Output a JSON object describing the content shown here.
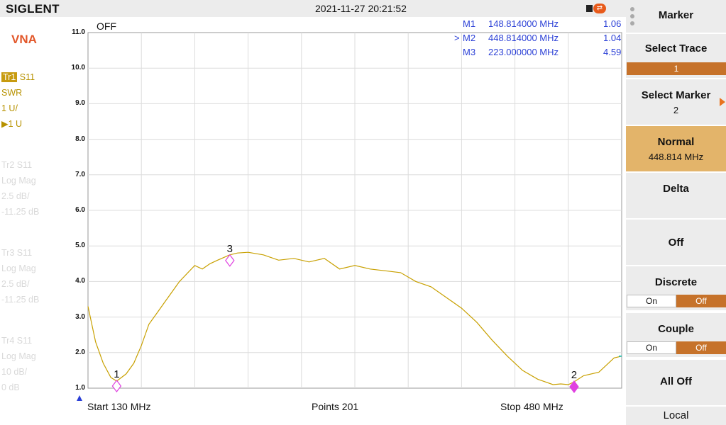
{
  "topbar": {
    "logo": "SIGLENT",
    "datetime": "2021-11-27 20:21:52",
    "usb_icon": "usb-icon"
  },
  "left_panel": {
    "mode": "VNA",
    "traces": [
      {
        "tag": "Tr1",
        "param": "S11",
        "format": "SWR",
        "scale": "1 U/",
        "ref": "▶1 U",
        "active": true
      },
      {
        "tag": "Tr2",
        "param": "S11",
        "format": "Log Mag",
        "scale": "2.5 dB/",
        "ref": "-11.25 dB",
        "active": false
      },
      {
        "tag": "Tr3",
        "param": "S11",
        "format": "Log Mag",
        "scale": "2.5 dB/",
        "ref": "-11.25 dB",
        "active": false
      },
      {
        "tag": "Tr4",
        "param": "S11",
        "format": "Log Mag",
        "scale": "10 dB/",
        "ref": "0 dB",
        "active": false
      }
    ]
  },
  "plot": {
    "off_label": "OFF",
    "start_label": "Start  130 MHz",
    "points_label": "Points  201",
    "stop_label": "Stop  480 MHz",
    "trace_color": "#c8a000",
    "marker_color": "#e040e0",
    "markers_table": [
      {
        "prefix": "",
        "name": "M1",
        "freq": "148.814000 MHz",
        "value": "1.06"
      },
      {
        "prefix": ">",
        "name": "M2",
        "freq": "448.814000 MHz",
        "value": "1.04"
      },
      {
        "prefix": "",
        "name": "M3",
        "freq": "223.000000 MHz",
        "value": "4.59"
      }
    ]
  },
  "chart_data": {
    "type": "line",
    "title": "",
    "xlabel": "",
    "ylabel": "",
    "xlim": [
      130,
      480
    ],
    "ylim": [
      1.0,
      11.0
    ],
    "grid": true,
    "y_ticks": [
      "11.0",
      "10.0",
      "9.0",
      "8.0",
      "7.0",
      "6.0",
      "5.0",
      "4.0",
      "3.0",
      "2.0",
      "1.0"
    ],
    "series": [
      {
        "x": [
          130,
          135,
          140,
          145,
          148.8,
          155,
          160,
          165,
          170,
          175,
          180,
          190,
          200,
          205,
          210,
          215,
          223,
          228,
          235,
          245,
          255,
          265,
          275,
          285,
          295,
          305,
          315,
          325,
          335,
          345,
          355,
          365,
          375,
          385,
          395,
          405,
          415,
          425,
          435,
          440,
          445,
          448.8,
          455,
          465,
          470,
          475,
          480
        ],
        "y": [
          3.3,
          2.3,
          1.7,
          1.3,
          1.2,
          1.4,
          1.7,
          2.2,
          2.8,
          3.1,
          3.4,
          4.0,
          4.45,
          4.35,
          4.5,
          4.6,
          4.75,
          4.8,
          4.82,
          4.75,
          4.6,
          4.65,
          4.55,
          4.65,
          4.35,
          4.45,
          4.35,
          4.3,
          4.25,
          4.0,
          3.85,
          3.55,
          3.25,
          2.85,
          2.35,
          1.9,
          1.5,
          1.25,
          1.1,
          1.12,
          1.1,
          1.18,
          1.35,
          1.45,
          1.65,
          1.85,
          1.9
        ]
      }
    ],
    "markers": [
      {
        "label": "1",
        "x": 148.8,
        "y": 1.06,
        "active": false
      },
      {
        "label": "2",
        "x": 448.8,
        "y": 1.04,
        "active": true
      },
      {
        "label": "3",
        "x": 223.0,
        "y": 4.59,
        "active": false
      }
    ]
  },
  "menu": {
    "title": "Marker",
    "select_trace": {
      "label": "Select Trace",
      "value": "1"
    },
    "select_marker": {
      "label": "Select Marker",
      "value": "2"
    },
    "normal": {
      "label": "Normal",
      "value": "448.814 MHz"
    },
    "delta": {
      "label": "Delta"
    },
    "off": {
      "label": "Off"
    },
    "discrete": {
      "label": "Discrete",
      "on": "On",
      "off": "Off"
    },
    "couple": {
      "label": "Couple",
      "on": "On",
      "off": "Off"
    },
    "all_off": {
      "label": "All Off"
    },
    "local": {
      "label": "Local"
    },
    "accent": "#c6722a",
    "highlight": "#e3b46a"
  }
}
